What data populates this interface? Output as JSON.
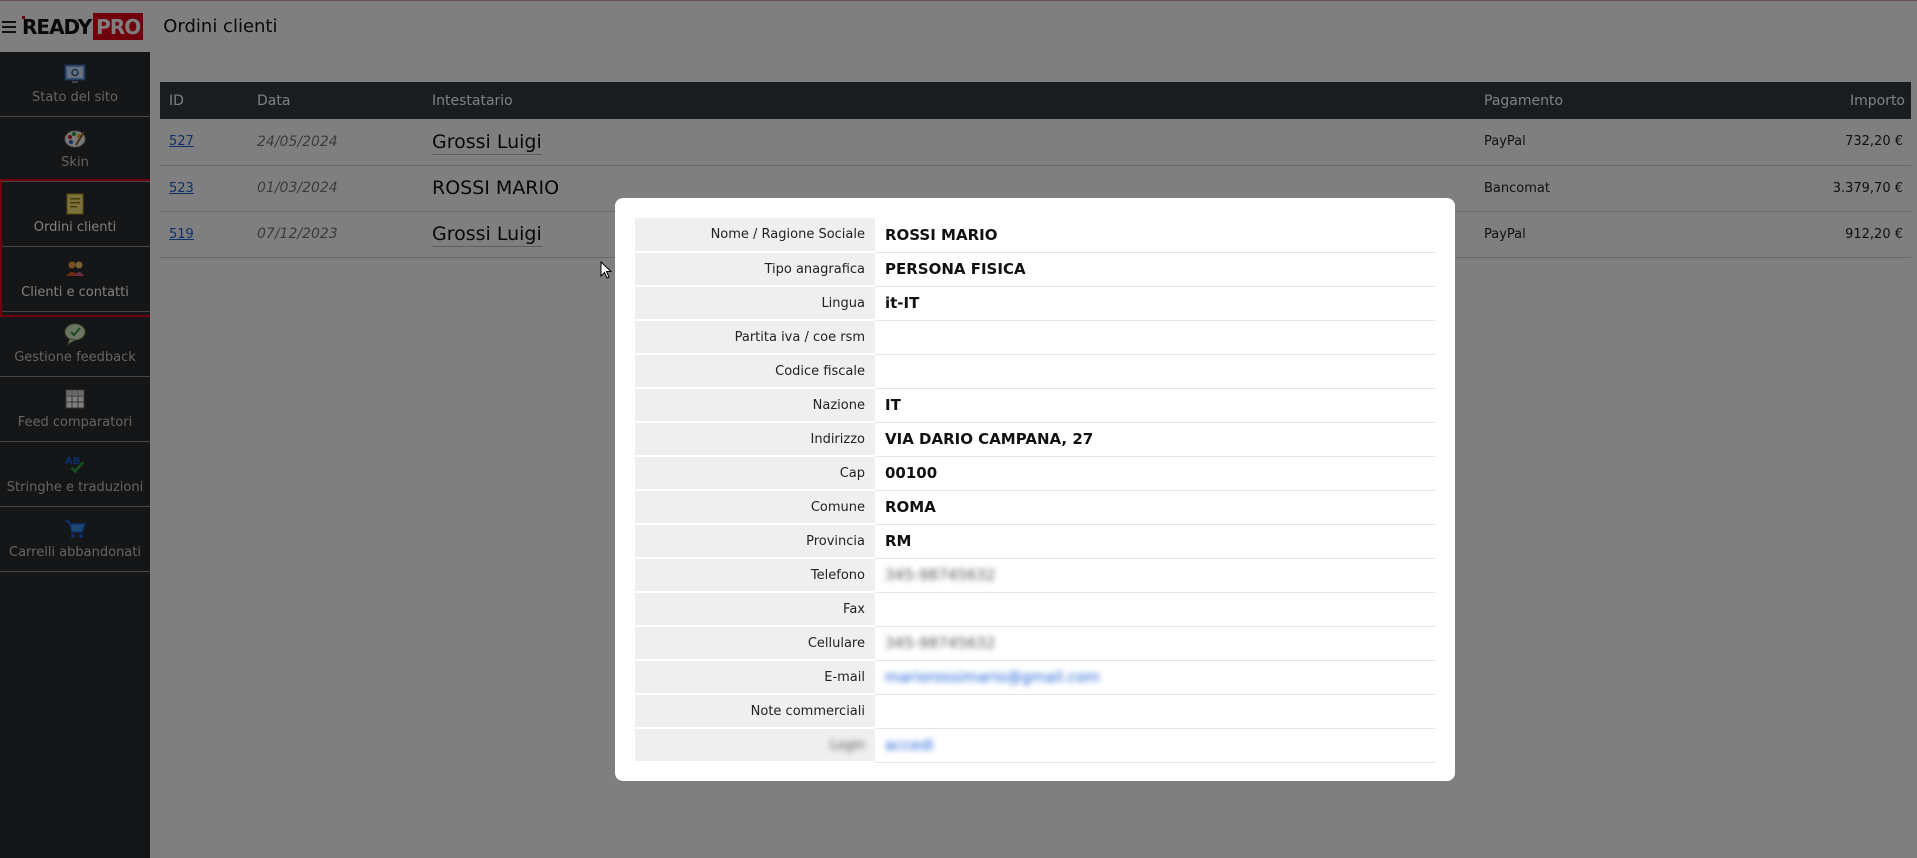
{
  "header": {
    "logo_ready": "READY",
    "logo_pro": "PRO",
    "title": "Ordini clienti"
  },
  "sidebar": {
    "items": [
      {
        "label": "Stato del sito",
        "icon": "monitor-icon"
      },
      {
        "label": "Skin",
        "icon": "palette-icon"
      },
      {
        "label": "Ordini clienti",
        "icon": "orders-icon"
      },
      {
        "label": "Clienti e contatti",
        "icon": "users-icon"
      },
      {
        "label": "Gestione feedback",
        "icon": "feedback-icon"
      },
      {
        "label": "Feed comparatori",
        "icon": "grid-icon"
      },
      {
        "label": "Stringhe e traduzioni",
        "icon": "translate-icon"
      },
      {
        "label": "Carrelli abbandonati",
        "icon": "cart-icon"
      }
    ]
  },
  "orders": {
    "columns": [
      "ID",
      "Data",
      "Intestatario",
      "Pagamento",
      "Importo"
    ],
    "rows": [
      {
        "id": "527",
        "date": "24/05/2024",
        "name": "Grossi Luigi",
        "payment": "PayPal",
        "amount": "732,20 €"
      },
      {
        "id": "523",
        "date": "01/03/2024",
        "name": "ROSSI MARIO",
        "payment": "Bancomat",
        "amount": "3.379,70 €"
      },
      {
        "id": "519",
        "date": "07/12/2023",
        "name": "Grossi Luigi",
        "payment": "PayPal",
        "amount": "912,20 €"
      }
    ]
  },
  "customer": {
    "fields": [
      {
        "label": "Nome / Ragione Sociale",
        "value": "ROSSI MARIO"
      },
      {
        "label": "Tipo anagrafica",
        "value": "PERSONA FISICA"
      },
      {
        "label": "Lingua",
        "value": "it-IT"
      },
      {
        "label": "Partita iva / coe rsm",
        "value": ""
      },
      {
        "label": "Codice fiscale",
        "value": ""
      },
      {
        "label": "Nazione",
        "value": "IT"
      },
      {
        "label": "Indirizzo",
        "value": "VIA DARIO CAMPANA, 27"
      },
      {
        "label": "Cap",
        "value": "00100"
      },
      {
        "label": "Comune",
        "value": "ROMA"
      },
      {
        "label": "Provincia",
        "value": "RM"
      },
      {
        "label": "Telefono",
        "value": "345-98745632"
      },
      {
        "label": "Fax",
        "value": ""
      },
      {
        "label": "Cellulare",
        "value": "345-98745632"
      },
      {
        "label": "E-mail",
        "value": "mariorossimario@gmail.com"
      },
      {
        "label": "Note commerciali",
        "value": ""
      },
      {
        "label": "Login",
        "value": "accedi"
      }
    ]
  }
}
